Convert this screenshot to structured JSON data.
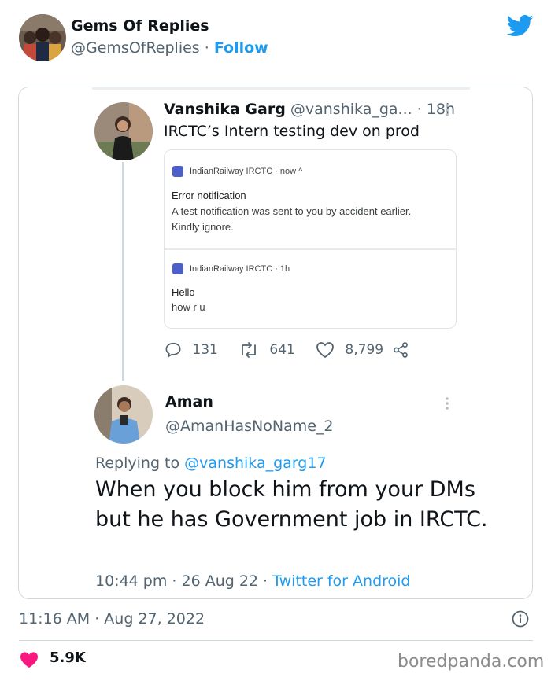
{
  "embed": {
    "author_name": "Gems Of Replies",
    "author_handle": "@GemsOfReplies",
    "separator": " · ",
    "follow_label": "Follow",
    "posted_time": "11:16 AM · Aug 27, 2022",
    "like_count": "5.9K",
    "icons": [
      "twitter-bird-icon",
      "info-icon",
      "heart-icon"
    ],
    "colors": {
      "accent": "#1d9bf0",
      "heart": "#f91880",
      "muted": "#536471"
    }
  },
  "quoted_thread": {
    "tweet1": {
      "author_name": "Vanshika Garg",
      "author_handle": "@vanshika_ga...",
      "age": "· 18h",
      "text": "IRCTC’s Intern testing dev on prod",
      "notifications": [
        {
          "app": "IndianRailway IRCTC · now ^",
          "title": "Error notification",
          "body_line1": "A test notification was sent to you by accident earlier.",
          "body_line2": "Kindly ignore."
        },
        {
          "app": "IndianRailway IRCTC · 1h",
          "title": "Hello",
          "body_line1": "how r u"
        }
      ],
      "actions": {
        "replies": "131",
        "retweets": "641",
        "likes": "8,799"
      }
    },
    "tweet2": {
      "author_name": "Aman",
      "author_handle": "@AmanHasNoName_2",
      "replying_prefix": "Replying to ",
      "replying_handle": "@vanshika_garg17",
      "text": "When you block him from your DMs but he has Government job in IRCTC.",
      "timestamp": "10:44 pm · 26 Aug 22 · ",
      "source": "Twitter for Android"
    }
  },
  "watermark": "boredpanda.com"
}
